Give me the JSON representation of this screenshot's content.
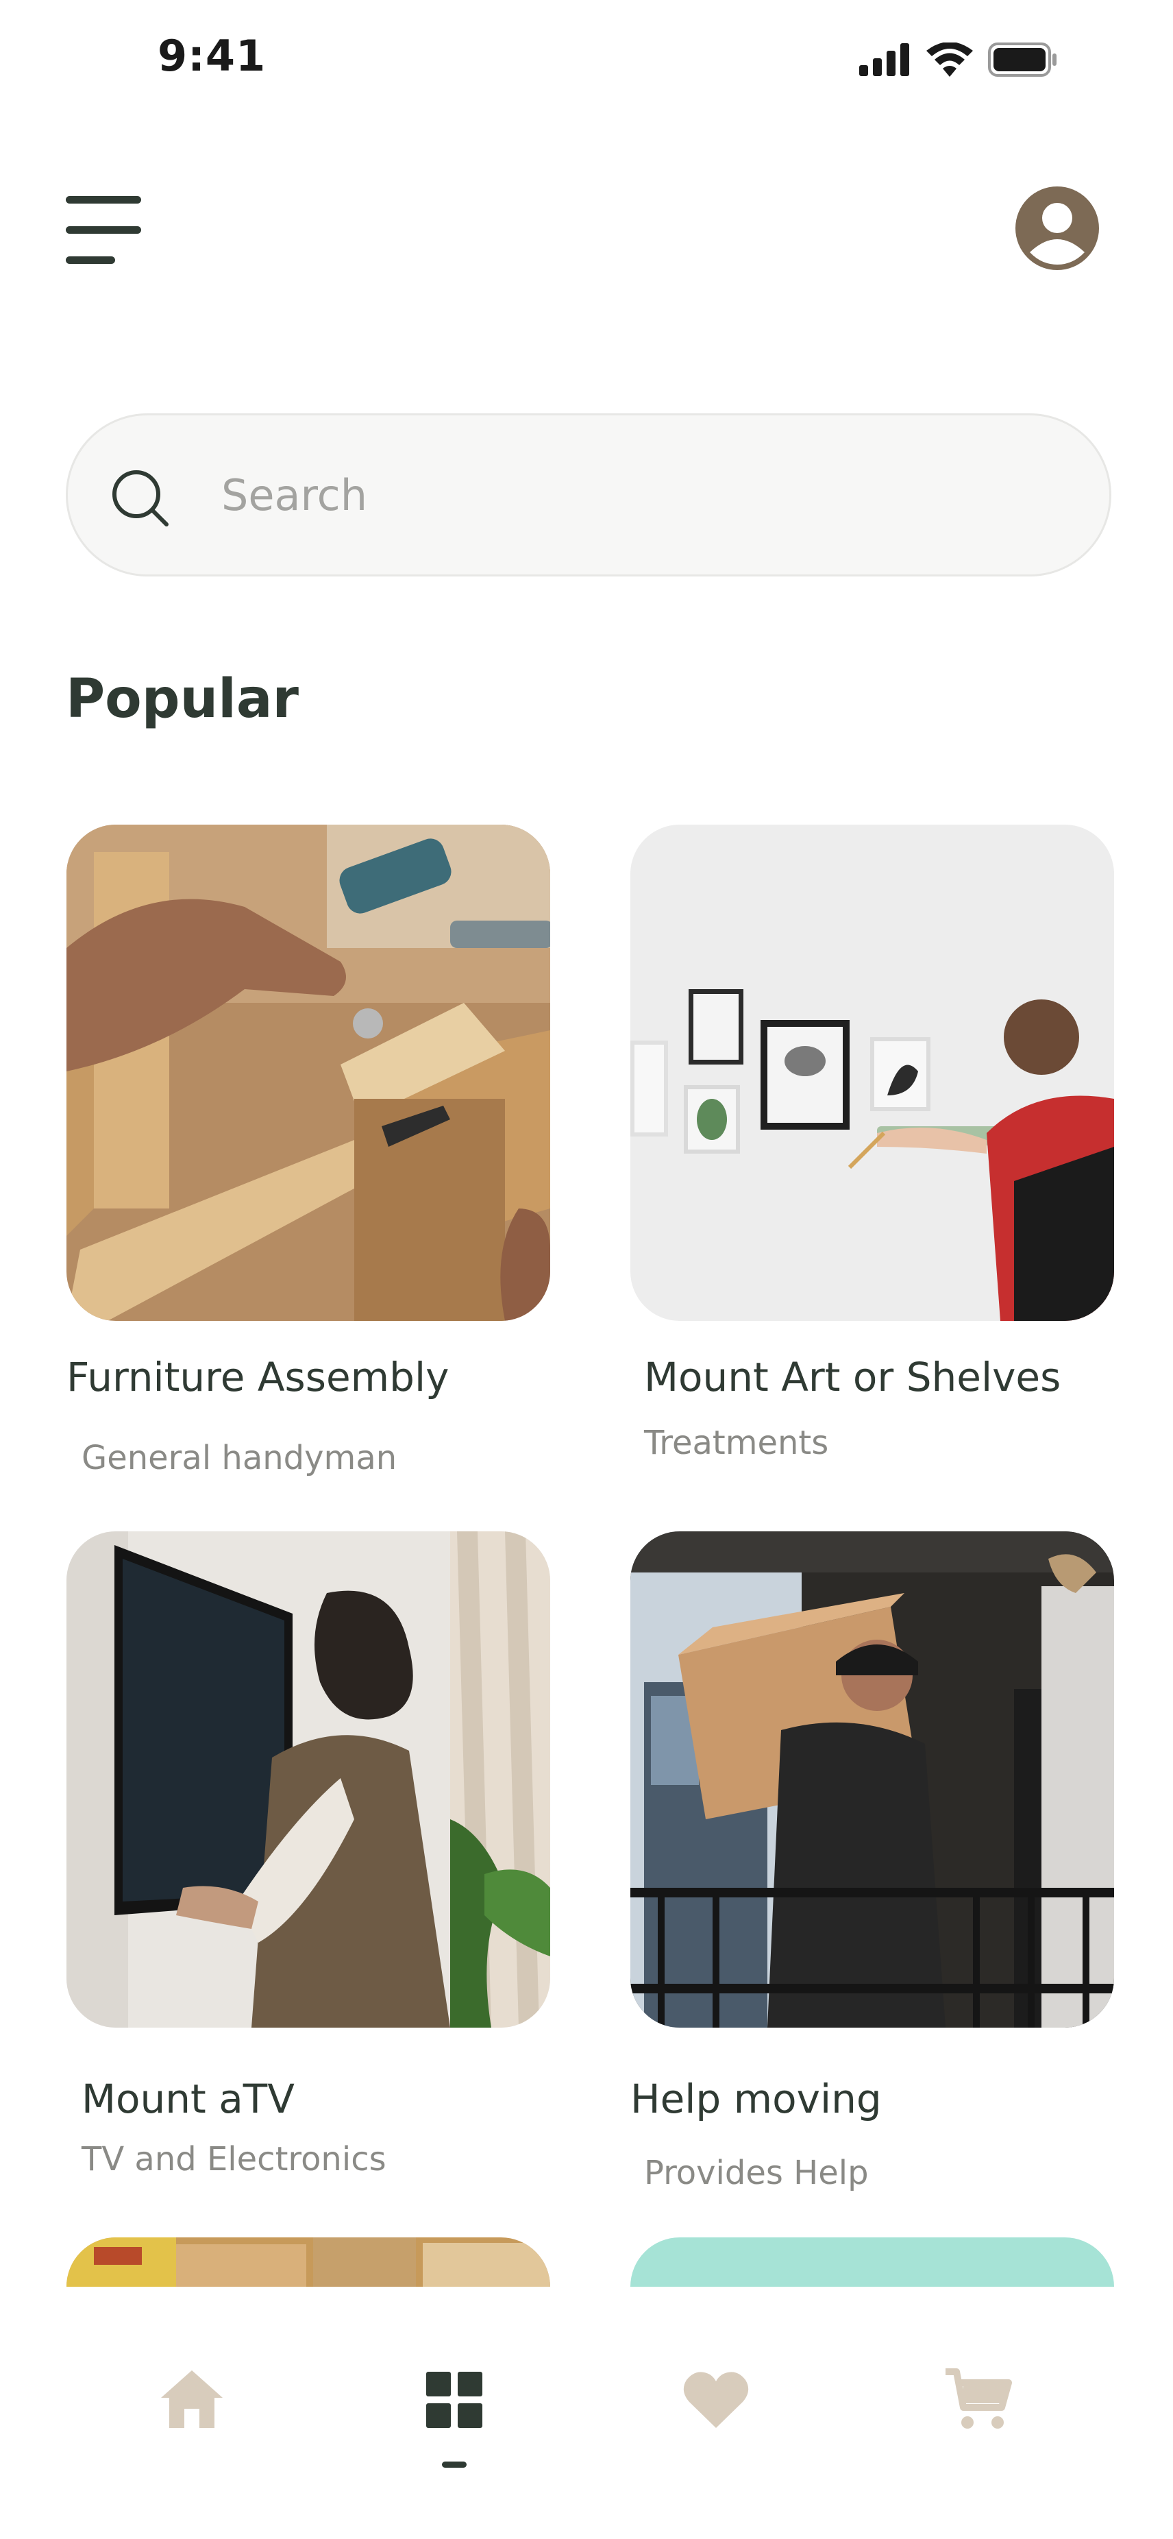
{
  "status_bar": {
    "time": "9:41"
  },
  "colors": {
    "primary_text": "#2f3a33",
    "secondary_text": "#8a8a86",
    "accent_brown": "#7d6a55",
    "nav_inactive": "#d8ccbc",
    "search_bg": "#f7f7f6",
    "teal": "#a6e3d6"
  },
  "header": {
    "menu_icon": "hamburger-menu-icon",
    "avatar_icon": "user-avatar-icon"
  },
  "search": {
    "placeholder": "Search",
    "value": "",
    "icon": "search-icon"
  },
  "section": {
    "title": "Popular"
  },
  "cards": [
    {
      "title": "Furniture Assembly",
      "subtitle": "General handyman",
      "image": "furniture-assembly-photo"
    },
    {
      "title": "Mount Art or Shelves",
      "subtitle": "Treatments",
      "image": "wall-art-photo"
    },
    {
      "title": "Mount aTV",
      "subtitle": "TV and Electronics",
      "image": "mount-tv-photo"
    },
    {
      "title": "Help moving",
      "subtitle": "Provides Help",
      "image": "moving-box-photo"
    },
    {
      "title": "",
      "subtitle": "",
      "image": "groceries-photo"
    },
    {
      "title": "",
      "subtitle": "",
      "image": "teal-card"
    }
  ],
  "bottom_nav": {
    "items": [
      {
        "icon": "home-icon",
        "active": false
      },
      {
        "icon": "grid-icon",
        "active": true
      },
      {
        "icon": "heart-icon",
        "active": false
      },
      {
        "icon": "cart-icon",
        "active": false
      }
    ]
  }
}
